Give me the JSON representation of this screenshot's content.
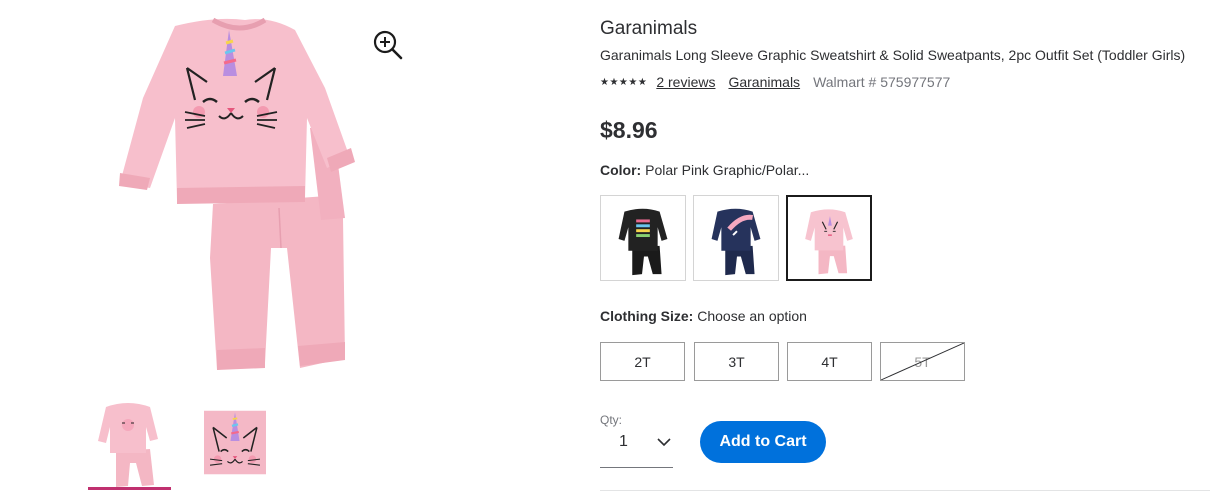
{
  "product": {
    "brand": "Garanimals",
    "title": "Garanimals Long Sleeve Graphic Sweatshirt & Solid Sweatpants, 2pc Outfit Set (Toddler Girls)",
    "stars_glyph": "★★★★★",
    "reviews_link": "2 reviews",
    "brand_link": "Garanimals",
    "walmart_number": "Walmart # 575977577",
    "price": "$8.96"
  },
  "color": {
    "label": "Color:",
    "selected": "Polar Pink Graphic/Polar...",
    "swatches": [
      "black-outfit",
      "navy-outfit",
      "pink-outfit"
    ],
    "selected_index": 2
  },
  "size": {
    "label": "Clothing Size:",
    "prompt": "Choose an option",
    "options": [
      "2T",
      "3T",
      "4T",
      "5T"
    ],
    "unavailable": [
      "5T"
    ]
  },
  "quantity": {
    "label": "Qty:",
    "value": "1"
  },
  "cart": {
    "button_label": "Add to Cart"
  },
  "colors": {
    "accent": "#0071dc",
    "thumb_indicator": "#c0306f",
    "sweat_pink": "#f4b8c6",
    "text": "#2e2f32"
  }
}
